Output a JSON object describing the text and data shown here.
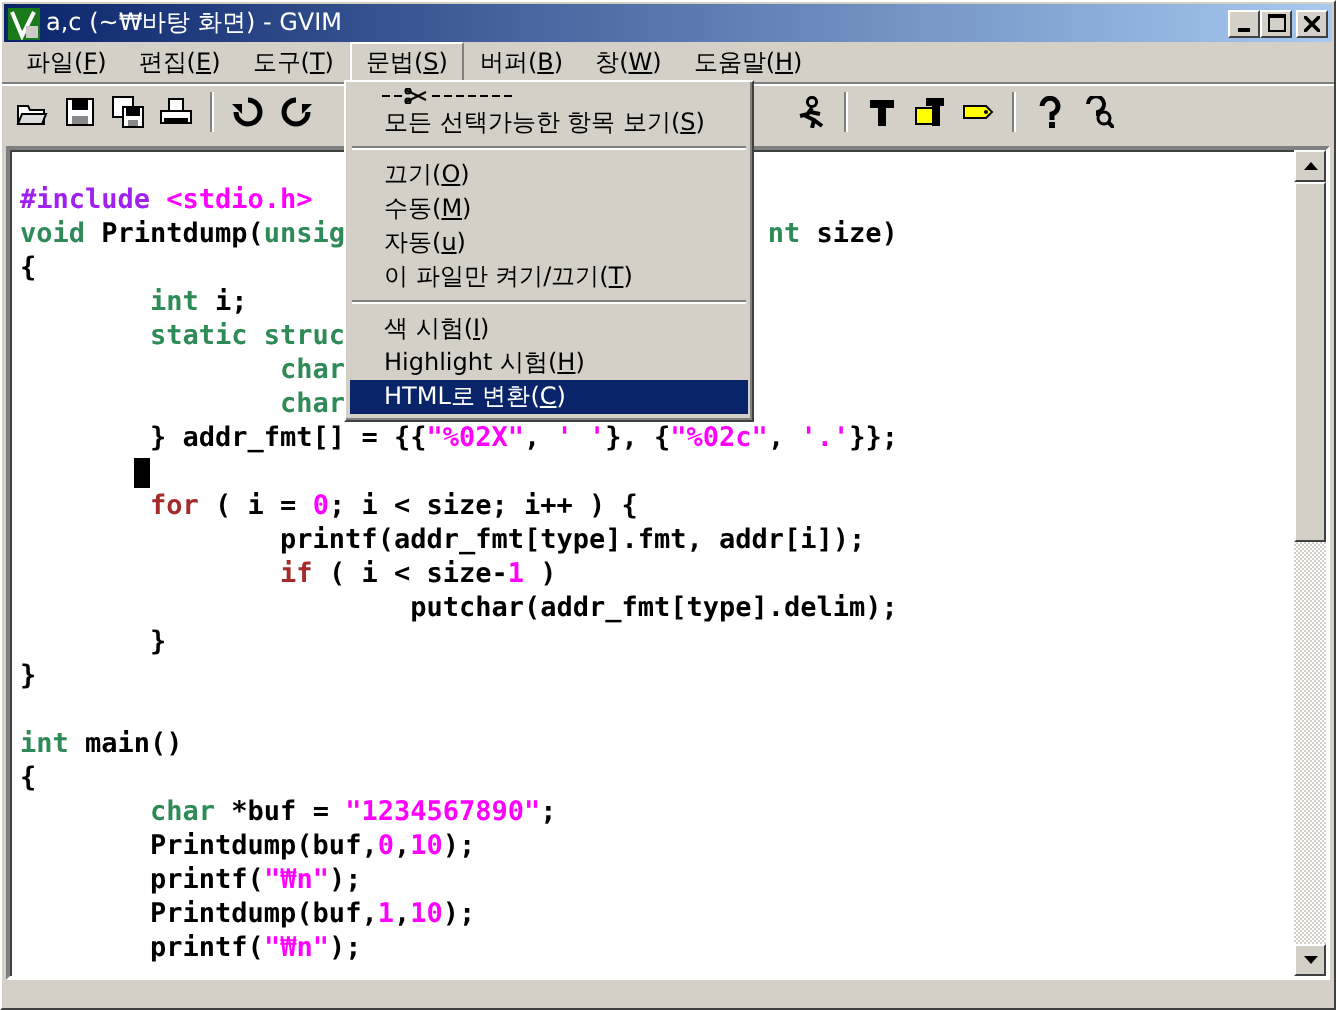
{
  "window": {
    "title": "a,c (~₩바탕 화면) - GVIM"
  },
  "menus": [
    {
      "before": "파일(",
      "key": "F",
      "after": ")",
      "selected": false
    },
    {
      "before": "편집(",
      "key": "E",
      "after": ")",
      "selected": false
    },
    {
      "before": "도구(",
      "key": "T",
      "after": ")",
      "selected": false
    },
    {
      "before": "문법(",
      "key": "S",
      "after": ")",
      "selected": true
    },
    {
      "before": "버퍼(",
      "key": "B",
      "after": ")",
      "selected": false
    },
    {
      "before": "창(",
      "key": "W",
      "after": ")",
      "selected": false
    },
    {
      "before": "도움말(",
      "key": "H",
      "after": ")",
      "selected": false
    }
  ],
  "toolbar": {
    "left": [
      {
        "kind": "open"
      },
      {
        "kind": "save"
      },
      {
        "kind": "save-all"
      },
      {
        "kind": "print"
      },
      {
        "kind": "separator"
      },
      {
        "kind": "undo"
      },
      {
        "kind": "redo"
      }
    ],
    "right": [
      {
        "kind": "run"
      },
      {
        "kind": "separator"
      },
      {
        "kind": "make"
      },
      {
        "kind": "tag-make"
      },
      {
        "kind": "tag"
      },
      {
        "kind": "separator"
      },
      {
        "kind": "help"
      },
      {
        "kind": "find-help"
      }
    ]
  },
  "dropdown": [
    {
      "kind": "tearoff"
    },
    {
      "kind": "item",
      "before": "모든 선택가능한 항목 보기(",
      "key": "S",
      "after": ")",
      "selected": false
    },
    {
      "kind": "separator"
    },
    {
      "kind": "item",
      "before": "끄기(",
      "key": "O",
      "after": ")",
      "selected": false
    },
    {
      "kind": "item",
      "before": "수동(",
      "key": "M",
      "after": ")",
      "selected": false
    },
    {
      "kind": "item",
      "before": "자동(",
      "key": "u",
      "after": ")",
      "selected": false
    },
    {
      "kind": "item",
      "before": "이 파일만 켜기/끄기(",
      "key": "T",
      "after": ")",
      "selected": false
    },
    {
      "kind": "separator"
    },
    {
      "kind": "item",
      "before": "색 시험(",
      "key": "I",
      "after": ")",
      "selected": false
    },
    {
      "kind": "item",
      "before": "Highlight 시험(",
      "key": "H",
      "after": ")",
      "selected": false
    },
    {
      "kind": "item",
      "before": "HTML로 변환(",
      "key": "C",
      "after": ")",
      "selected": true
    }
  ],
  "editor": {
    "lines": [
      {
        "kind": "blank"
      },
      {
        "kind": "code",
        "tokens": [
          {
            "text": "#include",
            "kind": "preproc"
          },
          {
            "text": " <stdio.h>",
            "kind": "include"
          }
        ]
      },
      {
        "kind": "split",
        "parts": [
          [
            {
              "text": "void",
              "kind": "type"
            },
            {
              "text": " Printdump(",
              "kind": "plain"
            },
            {
              "text": "unsig",
              "kind": "type"
            }
          ],
          [
            {
              "text": "nt",
              "kind": "type"
            },
            {
              "text": " size)",
              "kind": "plain"
            }
          ]
        ]
      },
      {
        "kind": "code",
        "tokens": [
          {
            "text": "{",
            "kind": "plain"
          }
        ]
      },
      {
        "kind": "code",
        "tokens": [
          {
            "text": "\tint",
            "kind": "type"
          },
          {
            "text": " i;",
            "kind": "plain"
          }
        ]
      },
      {
        "kind": "code",
        "tokens": [
          {
            "text": "\tstatic struc",
            "kind": "type"
          }
        ]
      },
      {
        "kind": "code",
        "tokens": [
          {
            "text": "\t\tchar",
            "kind": "type"
          }
        ]
      },
      {
        "kind": "code",
        "tokens": [
          {
            "text": "\t\tchar",
            "kind": "type"
          }
        ]
      },
      {
        "kind": "code",
        "tokens": [
          {
            "text": "\t} addr_fmt[] = {{",
            "kind": "plain"
          },
          {
            "text": "\"%02X\"",
            "kind": "constant"
          },
          {
            "text": ", ",
            "kind": "plain"
          },
          {
            "text": "' '",
            "kind": "constant"
          },
          {
            "text": "}, {",
            "kind": "plain"
          },
          {
            "text": "\"%02c\"",
            "kind": "constant"
          },
          {
            "text": ", ",
            "kind": "plain"
          },
          {
            "text": "'.'",
            "kind": "constant"
          },
          {
            "text": "}};",
            "kind": "plain"
          }
        ]
      },
      {
        "kind": "cursor"
      },
      {
        "kind": "code",
        "tokens": [
          {
            "text": "\tfor",
            "kind": "statement"
          },
          {
            "text": " ( i = ",
            "kind": "plain"
          },
          {
            "text": "0",
            "kind": "constant"
          },
          {
            "text": "; i < size; i++ ) {",
            "kind": "plain"
          }
        ]
      },
      {
        "kind": "code",
        "tokens": [
          {
            "text": "\t\tprintf(addr_fmt[type].fmt, addr[i]);",
            "kind": "plain"
          }
        ]
      },
      {
        "kind": "code",
        "tokens": [
          {
            "text": "\t\tif",
            "kind": "statement"
          },
          {
            "text": " ( i < size-",
            "kind": "plain"
          },
          {
            "text": "1",
            "kind": "constant"
          },
          {
            "text": " )",
            "kind": "plain"
          }
        ]
      },
      {
        "kind": "code",
        "tokens": [
          {
            "text": "\t\t\tputchar(addr_fmt[type].delim);",
            "kind": "plain"
          }
        ]
      },
      {
        "kind": "code",
        "tokens": [
          {
            "text": "\t}",
            "kind": "plain"
          }
        ]
      },
      {
        "kind": "code",
        "tokens": [
          {
            "text": "}",
            "kind": "plain"
          }
        ]
      },
      {
        "kind": "blank"
      },
      {
        "kind": "code",
        "tokens": [
          {
            "text": "int",
            "kind": "type"
          },
          {
            "text": " main()",
            "kind": "plain"
          }
        ]
      },
      {
        "kind": "code",
        "tokens": [
          {
            "text": "{",
            "kind": "plain"
          }
        ]
      },
      {
        "kind": "code",
        "tokens": [
          {
            "text": "\tchar",
            "kind": "type"
          },
          {
            "text": " *buf = ",
            "kind": "plain"
          },
          {
            "text": "\"1234567890\"",
            "kind": "constant"
          },
          {
            "text": ";",
            "kind": "plain"
          }
        ]
      },
      {
        "kind": "code",
        "tokens": [
          {
            "text": "\tPrintdump(buf,",
            "kind": "plain"
          },
          {
            "text": "0",
            "kind": "constant"
          },
          {
            "text": ",",
            "kind": "plain"
          },
          {
            "text": "10",
            "kind": "constant"
          },
          {
            "text": ");",
            "kind": "plain"
          }
        ]
      },
      {
        "kind": "code",
        "tokens": [
          {
            "text": "\tprintf(",
            "kind": "plain"
          },
          {
            "text": "\"₩n\"",
            "kind": "constant"
          },
          {
            "text": ");",
            "kind": "plain"
          }
        ]
      },
      {
        "kind": "code",
        "tokens": [
          {
            "text": "\tPrintdump(buf,",
            "kind": "plain"
          },
          {
            "text": "1",
            "kind": "constant"
          },
          {
            "text": ",",
            "kind": "plain"
          },
          {
            "text": "10",
            "kind": "constant"
          },
          {
            "text": ");",
            "kind": "plain"
          }
        ]
      },
      {
        "kind": "code",
        "tokens": [
          {
            "text": "\tprintf(",
            "kind": "plain"
          },
          {
            "text": "\"₩n\"",
            "kind": "constant"
          },
          {
            "text": ");",
            "kind": "plain"
          }
        ]
      }
    ]
  }
}
